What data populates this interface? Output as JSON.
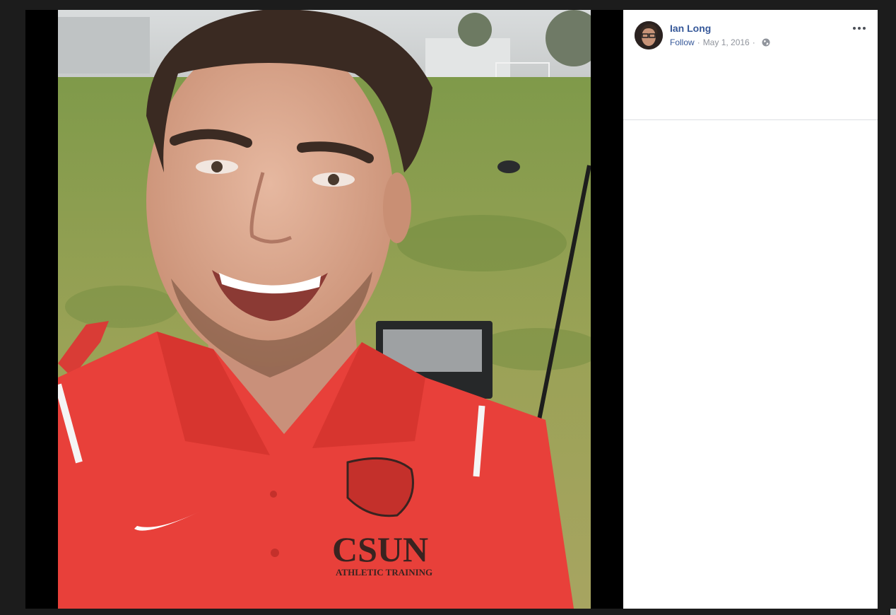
{
  "post": {
    "author_name": "Ian Long",
    "follow_label": "Follow",
    "separator": "·",
    "date": "May 1, 2016",
    "privacy_icon": "globe-icon",
    "more_icon": "more-options-icon"
  },
  "photo": {
    "shirt_logo_text": "CSUN",
    "shirt_sub_text": "ATHLETIC TRAINING"
  },
  "colors": {
    "link": "#365899",
    "meta": "#90949c",
    "shirt": "#e8403a",
    "grass": "#8a9a4a"
  }
}
